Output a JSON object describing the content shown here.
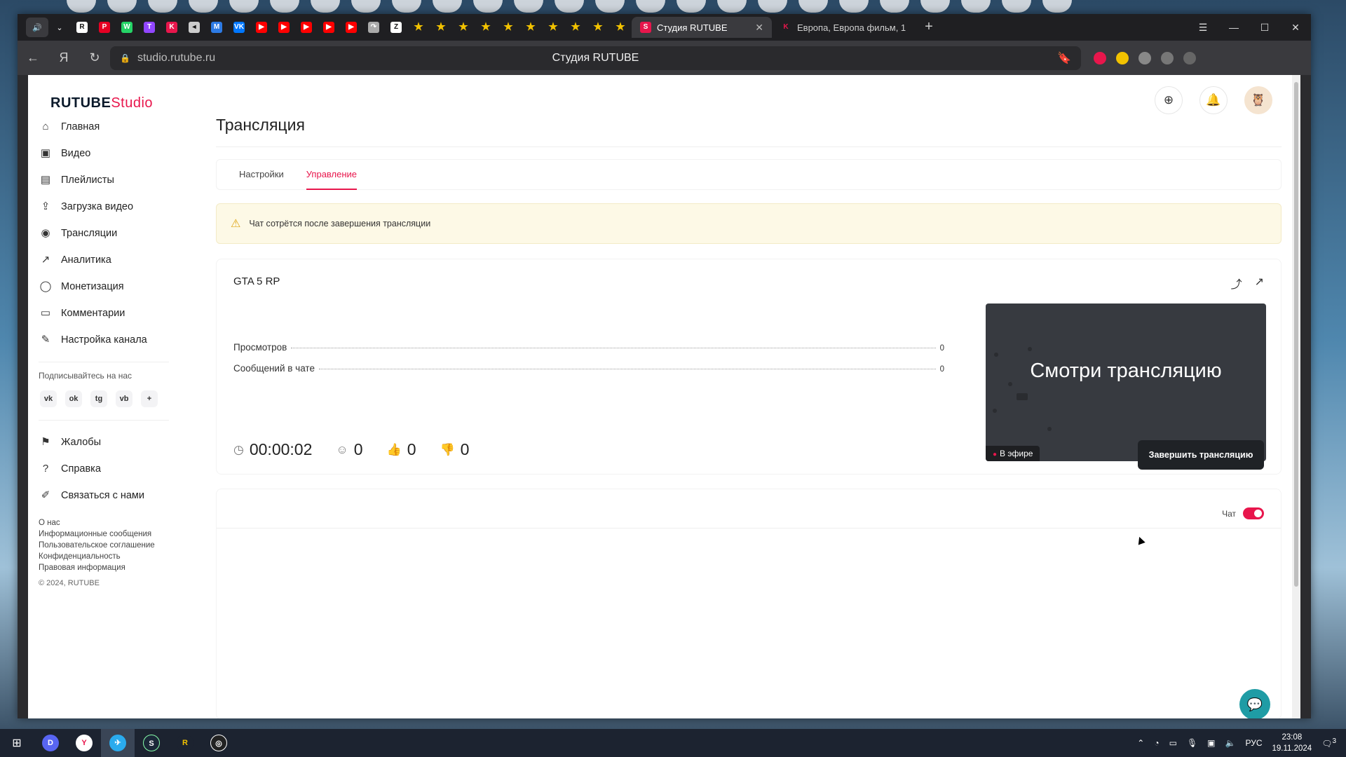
{
  "browser": {
    "active_tab": {
      "title": "Студия RUTUBE",
      "favicon": "S"
    },
    "other_tab": {
      "title": "Европа, Европа фильм, 1",
      "favicon": "K"
    },
    "url": "studio.rutube.ru",
    "page_title": "Студия RUTUBE",
    "pinned": [
      "R",
      "P",
      "W",
      "T",
      "K",
      "◂",
      "M",
      "VK",
      "▶",
      "▶",
      "▶",
      "▶",
      "▶",
      "↷",
      "Z",
      "★",
      "★",
      "★",
      "★",
      "★",
      "★",
      "★",
      "★",
      "★",
      "★"
    ]
  },
  "app": {
    "logo": "RUTUBE",
    "logo_suffix": "Studio"
  },
  "sidebar": {
    "items": [
      {
        "label": "Главная",
        "icon": "⌂"
      },
      {
        "label": "Видео",
        "icon": "▣"
      },
      {
        "label": "Плейлисты",
        "icon": "▤"
      },
      {
        "label": "Загрузка видео",
        "icon": "⇪"
      },
      {
        "label": "Трансляции",
        "icon": "◉"
      },
      {
        "label": "Аналитика",
        "icon": "↗"
      },
      {
        "label": "Монетизация",
        "icon": "◯"
      },
      {
        "label": "Комментарии",
        "icon": "▭"
      },
      {
        "label": "Настройка канала",
        "icon": "✎"
      }
    ],
    "follow_label": "Подписывайтесь на нас",
    "socials": [
      "vk",
      "ok",
      "tg",
      "vb",
      "+"
    ],
    "help_items": [
      {
        "label": "Жалобы",
        "icon": "⚑"
      },
      {
        "label": "Справка",
        "icon": "?"
      },
      {
        "label": "Связаться с нами",
        "icon": "✐"
      }
    ],
    "links": [
      "О нас",
      "Информационные сообщения",
      "Пользовательское соглашение",
      "Конфиденциальность",
      "Правовая информация"
    ],
    "copyright": "© 2024, RUTUBE"
  },
  "page": {
    "title": "Трансляция",
    "tabs": [
      "Настройки",
      "Управление"
    ],
    "active_tab": "Управление",
    "warning": "Чат сотрётся после завершения трансляции"
  },
  "stream": {
    "name": "GTA 5 RP",
    "stats": [
      {
        "label": "Просмотров",
        "value": "0"
      },
      {
        "label": "Сообщений в чате",
        "value": "0"
      }
    ],
    "timer": "00:00:02",
    "viewers": "0",
    "likes": "0",
    "dislikes": "0",
    "preview_text": "Смотри трансляцию",
    "live_badge": "В эфире",
    "end_button": "Завершить трансляцию"
  },
  "chat": {
    "label": "Чат",
    "enabled": true
  },
  "taskbar": {
    "lang": "РУС",
    "time": "23:08",
    "date": "19.11.2024",
    "notifications": "3"
  },
  "colors": {
    "accent": "#e8164c",
    "dark_button": "#1f2226",
    "warning_bg": "#fdf9e6",
    "support": "#1f9ca5"
  }
}
